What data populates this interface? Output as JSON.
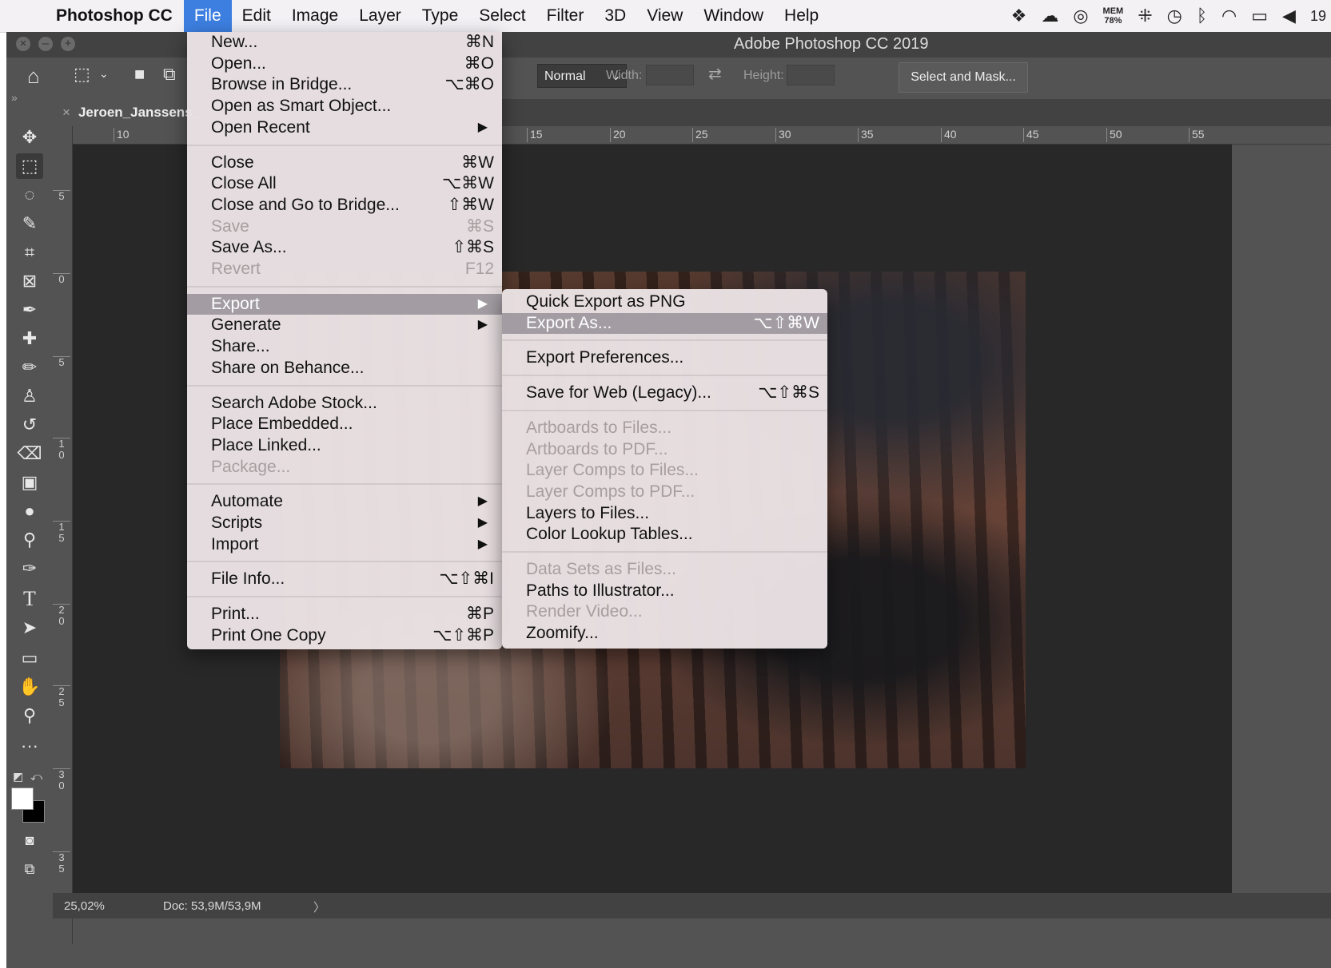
{
  "menubar": {
    "app_name": "Photoshop CC",
    "items": [
      "File",
      "Edit",
      "Image",
      "Layer",
      "Type",
      "Select",
      "Filter",
      "3D",
      "View",
      "Window",
      "Help"
    ],
    "mem_label": "MEM",
    "mem_value": "78%",
    "clock_partial": "19"
  },
  "window": {
    "title": "Adobe Photoshop CC 2019"
  },
  "options": {
    "mode_value": "Normal",
    "width_label": "Width:",
    "height_label": "Height:",
    "select_mask_label": "Select and Mask..."
  },
  "tab": {
    "close": "×",
    "name": "Jeroen_Janssens_"
  },
  "ruler_top": [
    "10",
    "15",
    "20",
    "25",
    "30",
    "35",
    "40",
    "45",
    "50",
    "55"
  ],
  "ruler_left": [
    "5",
    "0",
    "5",
    "1\n0",
    "1\n5",
    "2\n0",
    "2\n5",
    "3\n0",
    "3\n5"
  ],
  "status": {
    "zoom": "25,02%",
    "doc": "Doc: 53,9M/53,9M",
    "arrow": "〉"
  },
  "file_menu": [
    {
      "label": "New...",
      "shortcut": "⌘N"
    },
    {
      "label": "Open...",
      "shortcut": "⌘O"
    },
    {
      "label": "Browse in Bridge...",
      "shortcut": "⌥⌘O"
    },
    {
      "label": "Open as Smart Object...",
      "shortcut": ""
    },
    {
      "label": "Open Recent",
      "shortcut": "",
      "submenu": true
    },
    {
      "sep": true
    },
    {
      "label": "Close",
      "shortcut": "⌘W"
    },
    {
      "label": "Close All",
      "shortcut": "⌥⌘W"
    },
    {
      "label": "Close and Go to Bridge...",
      "shortcut": "⇧⌘W"
    },
    {
      "label": "Save",
      "shortcut": "⌘S",
      "disabled": true
    },
    {
      "label": "Save As...",
      "shortcut": "⇧⌘S"
    },
    {
      "label": "Revert",
      "shortcut": "F12",
      "disabled": true
    },
    {
      "sep": true
    },
    {
      "label": "Export",
      "shortcut": "",
      "submenu": true,
      "highlighted": true
    },
    {
      "label": "Generate",
      "shortcut": "",
      "submenu": true
    },
    {
      "label": "Share...",
      "shortcut": ""
    },
    {
      "label": "Share on Behance...",
      "shortcut": ""
    },
    {
      "sep": true
    },
    {
      "label": "Search Adobe Stock...",
      "shortcut": ""
    },
    {
      "label": "Place Embedded...",
      "shortcut": ""
    },
    {
      "label": "Place Linked...",
      "shortcut": ""
    },
    {
      "label": "Package...",
      "shortcut": "",
      "disabled": true
    },
    {
      "sep": true
    },
    {
      "label": "Automate",
      "shortcut": "",
      "submenu": true
    },
    {
      "label": "Scripts",
      "shortcut": "",
      "submenu": true
    },
    {
      "label": "Import",
      "shortcut": "",
      "submenu": true
    },
    {
      "sep": true
    },
    {
      "label": "File Info...",
      "shortcut": "⌥⇧⌘I"
    },
    {
      "sep": true
    },
    {
      "label": "Print...",
      "shortcut": "⌘P"
    },
    {
      "label": "Print One Copy",
      "shortcut": "⌥⇧⌘P"
    }
  ],
  "export_menu": [
    {
      "label": "Quick Export as PNG",
      "shortcut": ""
    },
    {
      "label": "Export As...",
      "shortcut": "⌥⇧⌘W",
      "highlighted": true
    },
    {
      "sep": true
    },
    {
      "label": "Export Preferences...",
      "shortcut": ""
    },
    {
      "sep": true
    },
    {
      "label": "Save for Web (Legacy)...",
      "shortcut": "⌥⇧⌘S"
    },
    {
      "sep": true
    },
    {
      "label": "Artboards to Files...",
      "shortcut": "",
      "disabled": true
    },
    {
      "label": "Artboards to PDF...",
      "shortcut": "",
      "disabled": true
    },
    {
      "label": "Layer Comps to Files...",
      "shortcut": "",
      "disabled": true
    },
    {
      "label": "Layer Comps to PDF...",
      "shortcut": "",
      "disabled": true
    },
    {
      "label": "Layers to Files...",
      "shortcut": ""
    },
    {
      "label": "Color Lookup Tables...",
      "shortcut": ""
    },
    {
      "sep": true
    },
    {
      "label": "Data Sets as Files...",
      "shortcut": "",
      "disabled": true
    },
    {
      "label": "Paths to Illustrator...",
      "shortcut": ""
    },
    {
      "label": "Render Video...",
      "shortcut": "",
      "disabled": true
    },
    {
      "label": "Zoomify...",
      "shortcut": ""
    }
  ],
  "icons": {
    "tools": [
      "move-tool-icon",
      "marquee-tool-icon",
      "lasso-tool-icon",
      "quick-select-tool-icon",
      "crop-tool-icon",
      "frame-tool-icon",
      "eyedropper-tool-icon",
      "healing-brush-tool-icon",
      "brush-tool-icon",
      "clone-stamp-tool-icon",
      "history-brush-tool-icon",
      "eraser-tool-icon",
      "gradient-tool-icon",
      "blur-tool-icon",
      "dodge-tool-icon",
      "pen-tool-icon",
      "type-tool-icon",
      "path-select-tool-icon",
      "rectangle-tool-icon",
      "hand-tool-icon",
      "zoom-tool-icon",
      "more-tools-icon"
    ]
  },
  "colors": {
    "menu_highlight": "#3d7fe0",
    "menu_item_highlight": "#a39da3",
    "app_bg": "#535353",
    "canvas_bg": "#282828"
  }
}
